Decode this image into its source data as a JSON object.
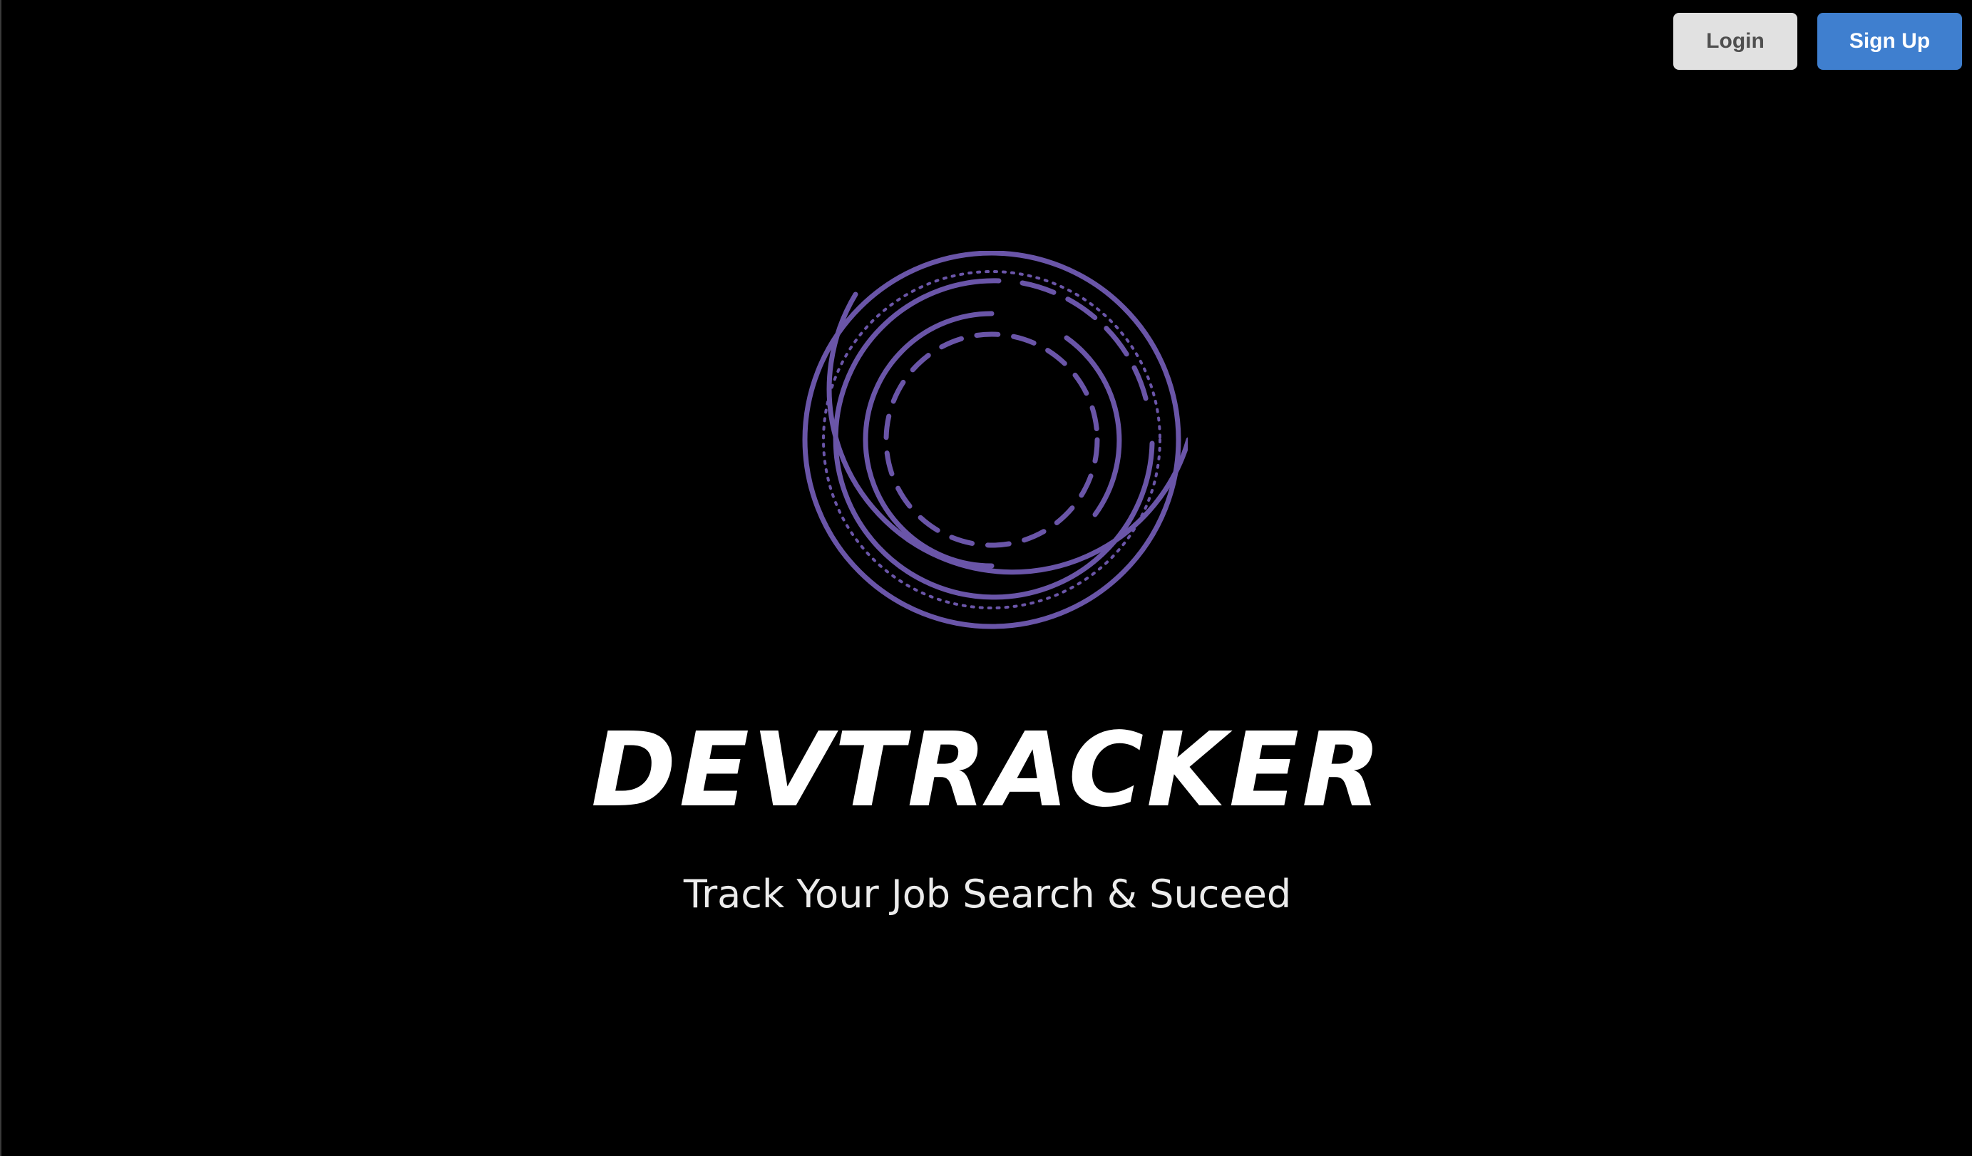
{
  "header": {
    "login_label": "Login",
    "signup_label": "Sign Up"
  },
  "hero": {
    "logo_icon": "concentric-rings-logo-icon",
    "brand_name": "DEVTRACKER",
    "tagline": "Track Your Job Search & Suceed"
  },
  "colors": {
    "background": "#000000",
    "logo_purple": "#6a55a8",
    "login_bg": "#e1e1e1",
    "signup_bg": "#3f7fcf"
  }
}
